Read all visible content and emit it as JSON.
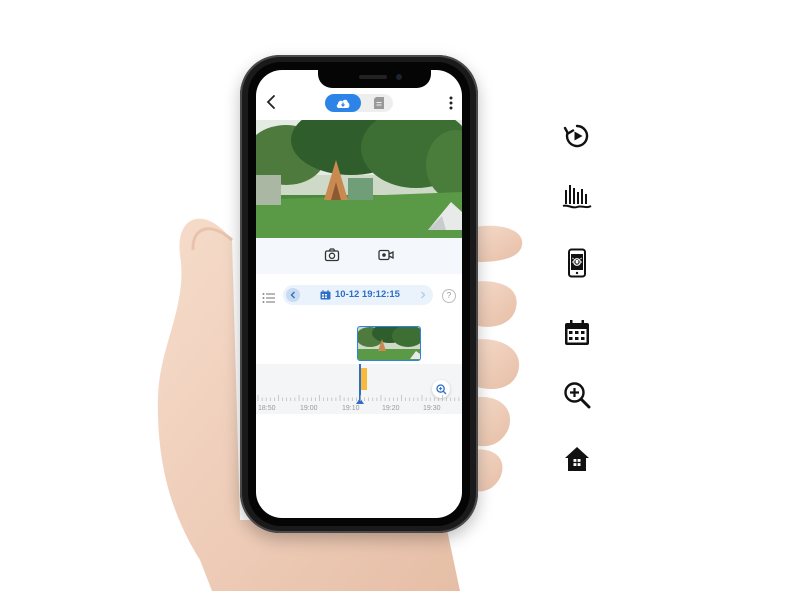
{
  "player": {
    "date_label": "10-12 19:12:15",
    "help_label": "?",
    "timeline_labels": [
      "18:50",
      "19:00",
      "19:10",
      "19:20",
      "19:30"
    ]
  },
  "feature_icons": [
    "playback-icon",
    "sound-wave-icon",
    "phone-alarm-icon",
    "calendar-icon",
    "zoom-in-icon",
    "home-icon"
  ],
  "colors": {
    "accent": "#2d84e8",
    "event": "#f9b93b",
    "icon": "#111111"
  }
}
